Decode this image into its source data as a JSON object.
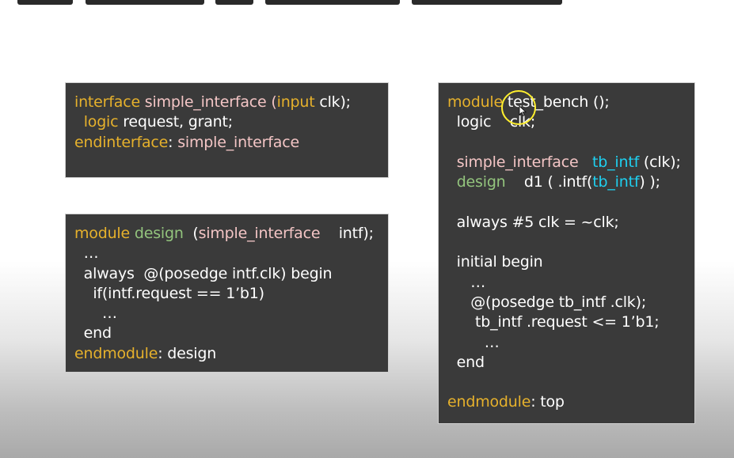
{
  "panels": {
    "interface": {
      "lines": [
        [
          {
            "t": "interface",
            "c": "kw"
          },
          {
            "t": " simple_interface (",
            "c": "id"
          },
          {
            "t": "input",
            "c": "kw"
          },
          {
            "t": " clk);",
            "c": "wh"
          }
        ],
        [
          {
            "t": "  ",
            "c": "wh"
          },
          {
            "t": "logic",
            "c": "kw"
          },
          {
            "t": " request, grant;",
            "c": "wh"
          }
        ],
        [
          {
            "t": "endinterface",
            "c": "kw"
          },
          {
            "t": ": ",
            "c": "wh"
          },
          {
            "t": "simple_interface",
            "c": "id"
          }
        ]
      ]
    },
    "design": {
      "lines": [
        [
          {
            "t": "module",
            "c": "kw"
          },
          {
            "t": " design",
            "c": "gr"
          },
          {
            "t": "  (",
            "c": "wh"
          },
          {
            "t": "simple_interface",
            "c": "id"
          },
          {
            "t": "    intf);",
            "c": "wh"
          }
        ],
        [
          {
            "t": "  …",
            "c": "wh"
          }
        ],
        [
          {
            "t": "  always  @(posedge intf.clk) begin",
            "c": "wh"
          }
        ],
        [
          {
            "t": "    if(intf.request == 1’b1)",
            "c": "wh"
          }
        ],
        [
          {
            "t": "      …",
            "c": "wh"
          }
        ],
        [
          {
            "t": "  end",
            "c": "wh"
          }
        ],
        [
          {
            "t": "endmodule",
            "c": "kw"
          },
          {
            "t": ": design",
            "c": "wh"
          }
        ]
      ]
    },
    "testbench": {
      "lines": [
        [
          {
            "t": "module",
            "c": "kw"
          },
          {
            "t": " test_bench ();",
            "c": "wh"
          }
        ],
        [
          {
            "t": "  logic    clk;",
            "c": "wh"
          }
        ],
        [
          {
            "t": "",
            "c": "wh"
          }
        ],
        [
          {
            "t": "  ",
            "c": "wh"
          },
          {
            "t": "simple_interface",
            "c": "id"
          },
          {
            "t": "   ",
            "c": "wh"
          },
          {
            "t": "tb_intf",
            "c": "cy"
          },
          {
            "t": " (clk);",
            "c": "wh"
          }
        ],
        [
          {
            "t": "  ",
            "c": "wh"
          },
          {
            "t": "design",
            "c": "gr"
          },
          {
            "t": "    d1 ( .intf(",
            "c": "wh"
          },
          {
            "t": "tb_intf",
            "c": "cy"
          },
          {
            "t": ") );",
            "c": "wh"
          }
        ],
        [
          {
            "t": "",
            "c": "wh"
          }
        ],
        [
          {
            "t": "  always #5 clk = ~clk;",
            "c": "wh"
          }
        ],
        [
          {
            "t": "",
            "c": "wh"
          }
        ],
        [
          {
            "t": "  initial begin",
            "c": "wh"
          }
        ],
        [
          {
            "t": "     …",
            "c": "wh"
          }
        ],
        [
          {
            "t": "     @(posedge tb_intf .clk);",
            "c": "wh"
          }
        ],
        [
          {
            "t": "      tb_intf .request <= 1’b1;",
            "c": "wh"
          }
        ],
        [
          {
            "t": "        …",
            "c": "wh"
          }
        ],
        [
          {
            "t": "  end",
            "c": "wh"
          }
        ],
        [
          {
            "t": "",
            "c": "wh"
          }
        ],
        [
          {
            "t": "endmodule",
            "c": "kw"
          },
          {
            "t": ": top",
            "c": "wh"
          }
        ]
      ]
    }
  },
  "colors": {
    "keyword": "#e6b12c",
    "identifier": "#f3c5c5",
    "module_name": "#93c47d",
    "instance": "#1fd0f0",
    "panel_bg": "#3a3a3a",
    "cursor_highlight": "#ffef2e"
  },
  "icons": {
    "cursor": "mouse-pointer-icon",
    "highlight": "cursor-highlight-ring-icon"
  }
}
